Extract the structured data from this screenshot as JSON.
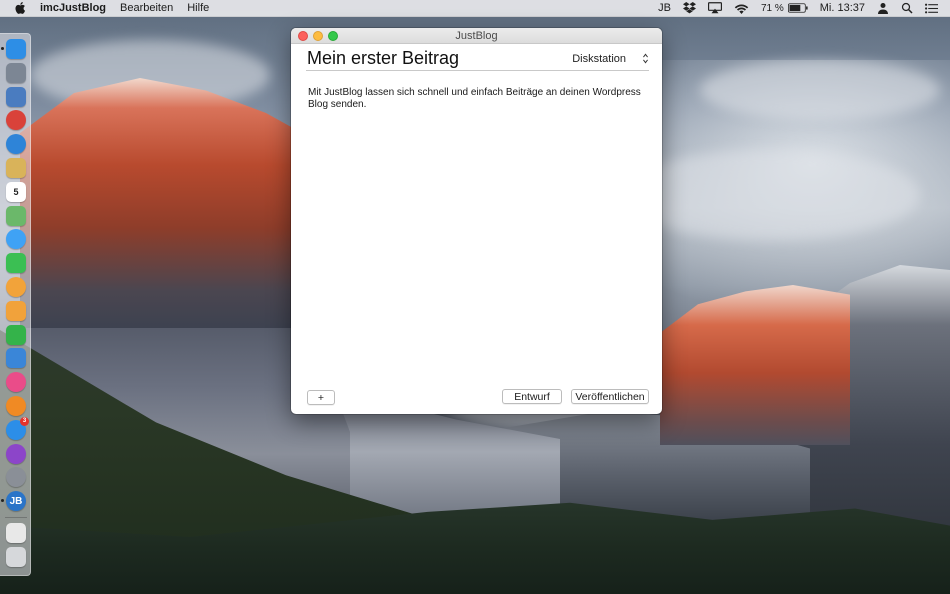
{
  "menubar": {
    "app_name": "imcJustBlog",
    "menus": [
      "Bearbeiten",
      "Hilfe"
    ],
    "user_initials": "JB",
    "battery_percent": "71 %",
    "clock": "Mi. 13:37"
  },
  "window": {
    "title": "JustBlog",
    "post_title": "Mein erster Beitrag",
    "blog_selector": {
      "selected": "Diskstation"
    },
    "body_text": "Mit JustBlog lassen sich schnell und einfach Beiträge an deinen Wordpress Blog senden.",
    "add_label": "+",
    "draft_label": "Entwurf",
    "publish_label": "Veröffentlichen"
  },
  "dock": {
    "items": [
      {
        "icon": "finder-icon",
        "color": "#2d8ee6"
      },
      {
        "icon": "launchpad-icon",
        "color": "#7c8694"
      },
      {
        "icon": "preview-icon",
        "color": "#4a7cc0"
      },
      {
        "icon": "chrome-icon",
        "color": "#d9423a"
      },
      {
        "icon": "safari-icon",
        "color": "#2e84d8"
      },
      {
        "icon": "notes-icon",
        "color": "#d9b35a"
      },
      {
        "icon": "calendar-icon",
        "color": "#ffffff",
        "text": "5"
      },
      {
        "icon": "maps-icon",
        "color": "#6bb86a"
      },
      {
        "icon": "messages-icon",
        "color": "#3fa2f5"
      },
      {
        "icon": "facetime-icon",
        "color": "#3bbf53"
      },
      {
        "icon": "photos-icon",
        "color": "#f2a33a"
      },
      {
        "icon": "pages-icon",
        "color": "#f1a23b"
      },
      {
        "icon": "numbers-icon",
        "color": "#34b34a"
      },
      {
        "icon": "keynote-icon",
        "color": "#3a86d8"
      },
      {
        "icon": "itunes-icon",
        "color": "#ea4c89"
      },
      {
        "icon": "ibooks-icon",
        "color": "#f08a24"
      },
      {
        "icon": "app-store-icon",
        "color": "#2c8ee8",
        "badge": "3"
      },
      {
        "icon": "podcasts-icon",
        "color": "#8c45c9"
      },
      {
        "icon": "system-preferences-icon",
        "color": "#8a8f97"
      },
      {
        "icon": "justblog-icon",
        "color": "#2a74c8",
        "text": "JB"
      }
    ],
    "trailing": [
      {
        "icon": "downloads-stack-icon",
        "color": "#e8e8e8"
      },
      {
        "icon": "trash-icon",
        "color": "#d6d8db"
      }
    ]
  }
}
